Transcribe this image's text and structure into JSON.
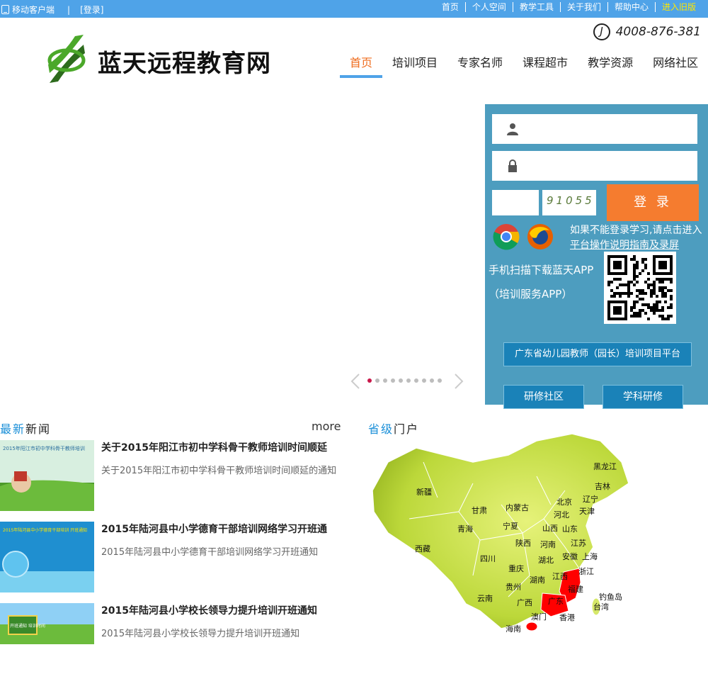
{
  "topbar": {
    "mobile_client": "移动客户端",
    "login_link": "[登录]",
    "links": [
      "首页",
      "个人空间",
      "教学工具",
      "关于我们",
      "帮助中心"
    ],
    "old_version": "进入旧版"
  },
  "header": {
    "site_name": "蓝天远程教育网",
    "hotline": "4008-876-381"
  },
  "nav": {
    "tabs": [
      "首页",
      "培训项目",
      "专家名师",
      "课程超市",
      "教学资源",
      "网络社区"
    ],
    "active": "首页"
  },
  "login": {
    "captcha_text": "91055",
    "login_button": "登 录",
    "hint_text": "如果不能登录学习,请点击进入",
    "hint_link": "平台操作说明指南及录屏",
    "app_line1": "手机扫描下载蓝天APP",
    "app_line2": "（培训服务APP）",
    "gd_button": "广东省幼儿园教师（园长）培训项目平台",
    "community_button": "研修社区",
    "subject_button": "学科研修"
  },
  "slider": {
    "dot_count": 10,
    "active_dot": 1
  },
  "news": {
    "title_a": "最新",
    "title_b": "新闻",
    "more": "more",
    "items": [
      {
        "title": "关于2015年阳江市初中学科骨干教师培训时间顺延",
        "summary": "关于2015年阳江市初中学科骨干教师培训时间顺延的通知",
        "thumb_caption": "2015年阳江市初中学科骨干教师培训"
      },
      {
        "title": "2015年陆河县中小学德育干部培训网络学习开班通",
        "summary": "2015年陆河县中小学德育干部培训网络学习开班通知",
        "thumb_caption": "2015年陆河县中小学德育干部培训 开班通知"
      },
      {
        "title": "2015年陆河县小学校长领导力提升培训开班通知",
        "summary": "2015年陆河县小学校长领导力提升培训开班通知",
        "thumb_caption": "开班通知 培训时间"
      }
    ]
  },
  "portal": {
    "title_a": "省级",
    "title_b": "门户",
    "provinces": [
      "黑龙江",
      "吉林",
      "辽宁",
      "新疆",
      "内蒙古",
      "北京",
      "天津",
      "甘肃",
      "河北",
      "宁夏",
      "山西",
      "山东",
      "青海",
      "陕西",
      "河南",
      "江苏",
      "西藏",
      "四川",
      "湖北",
      "安徽",
      "上海",
      "重庆",
      "浙江",
      "湖南",
      "江西",
      "贵州",
      "福建",
      "钓鱼岛",
      "云南",
      "广西",
      "广东",
      "台湾",
      "澳门",
      "香港",
      "海南"
    ],
    "highlight_color": "#ff0000"
  },
  "colors": {
    "topbar": "#4fa3e8",
    "login_panel": "#4d9dbf",
    "login_button": "#f57c2f",
    "nav_active": "#ef6c1e"
  }
}
